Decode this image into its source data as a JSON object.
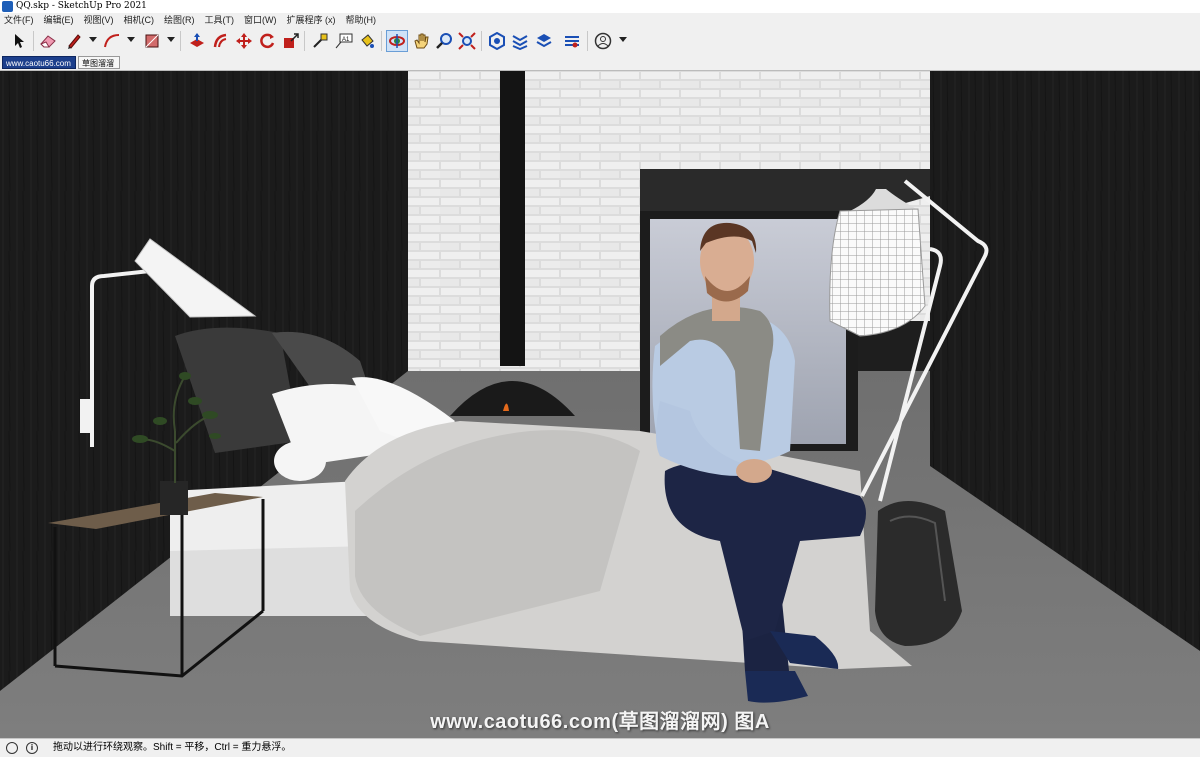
{
  "window": {
    "title": "QQ.skp - SketchUp Pro 2021"
  },
  "menu": [
    "文件(F)",
    "编辑(E)",
    "视图(V)",
    "相机(C)",
    "绘图(R)",
    "工具(T)",
    "窗口(W)",
    "扩展程序 (x)",
    "帮助(H)"
  ],
  "toolbar": {
    "tools": [
      "select-tool",
      "eraser-tool",
      "pencil-tool",
      "arc-tool",
      "rectangle-tool",
      "push-pull-tool",
      "offset-tool",
      "move-tool",
      "rotate-tool",
      "scale-tool",
      "tape-measure-tool",
      "text-tool",
      "paint-bucket-tool",
      "orbit-tool",
      "pan-tool",
      "zoom-tool",
      "zoom-extents-tool",
      "warehouse-tool",
      "extension-warehouse-tool",
      "layout-tool",
      "extension-manager-tool",
      "account-tool"
    ],
    "active_tool": "orbit-tool"
  },
  "scene_tabs": [
    "www.caotu66.com",
    "草图溜溜"
  ],
  "active_tab": 0,
  "watermark": "www.caotu66.com(草图溜溜网) 图A",
  "status": {
    "message": "拖动以进行环绕观察。Shift = 平移，Ctrl = 重力悬浮。"
  },
  "colors": {
    "active_tab": "#1c3f8c",
    "wall": "#1c1c1c",
    "brick": "#e9e9e9",
    "floor": "#7d7d7d"
  }
}
